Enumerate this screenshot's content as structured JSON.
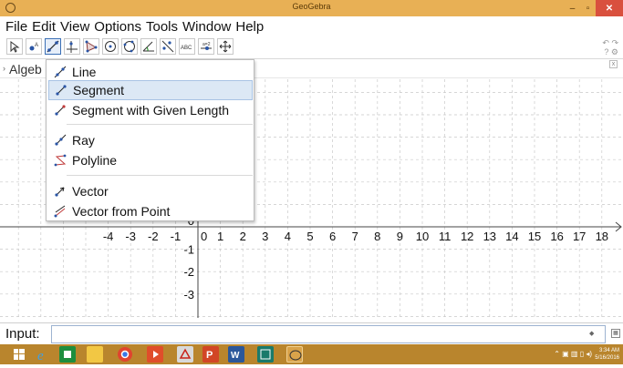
{
  "window": {
    "title": "GeoGebra",
    "controls": {
      "minimize": "–",
      "maximize": "▫",
      "close": "✕"
    }
  },
  "menu": [
    "File",
    "Edit",
    "View",
    "Options",
    "Tools",
    "Window",
    "Help"
  ],
  "toolbar": {
    "tools": [
      "move-tool",
      "point-tool",
      "line-tool",
      "perpendicular-line-tool",
      "polygon-tool",
      "circle-tool",
      "circle-through-points-tool",
      "angle-tool",
      "reflect-tool",
      "text-tool",
      "slider-tool",
      "move-graphics-tool"
    ],
    "active_index": 2,
    "undo": "↶",
    "redo": "↷"
  },
  "algebra_panel": {
    "label": "Algeb",
    "expand_arrow": "›",
    "close": "x"
  },
  "line_tools_menu": {
    "items": [
      {
        "label": "Line",
        "icon": "line-icon",
        "selected": false
      },
      {
        "label": "Segment",
        "icon": "segment-icon",
        "selected": true
      },
      {
        "label": "Segment with Given Length",
        "icon": "segment-given-length-icon",
        "selected": false
      },
      {
        "label": "Ray",
        "icon": "ray-icon",
        "selected": false
      },
      {
        "label": "Polyline",
        "icon": "polyline-icon",
        "selected": false
      },
      {
        "label": "Vector",
        "icon": "vector-icon",
        "selected": false
      },
      {
        "label": "Vector from Point",
        "icon": "vector-from-point-icon",
        "selected": false
      }
    ]
  },
  "graphics": {
    "x_ticks": [
      "-4",
      "-3",
      "-2",
      "-1",
      "0",
      "1",
      "2",
      "3",
      "4",
      "5",
      "6",
      "7",
      "8",
      "9",
      "10",
      "11",
      "12",
      "13",
      "14",
      "15",
      "16",
      "17",
      "18"
    ],
    "y_ticks": [
      "0",
      "-1",
      "-2",
      "-3"
    ],
    "grid": true,
    "grid_color": "#c9c9c9",
    "axis_color": "#444444"
  },
  "input_bar": {
    "label": "Input:",
    "value": "",
    "keyboard_icon": "keyboard-icon"
  },
  "taskbar": {
    "apps": [
      "windows-start-icon",
      "internet-explorer-icon",
      "store-icon",
      "file-explorer-icon",
      "chrome-icon",
      "media-player-icon",
      "acrobat-icon",
      "powerpoint-icon",
      "word-icon",
      "publisher-icon",
      "geogebra-icon"
    ],
    "clock_time": "3:34 AM",
    "clock_date": "5/16/2016",
    "tray": "⌃ ▣ ▥ ▯ ◂)"
  },
  "colors": {
    "title_bar": "#e8b055",
    "taskbar": "#b9852d",
    "selection": "#dce8f5",
    "active_tool": "#3a6fb5"
  }
}
